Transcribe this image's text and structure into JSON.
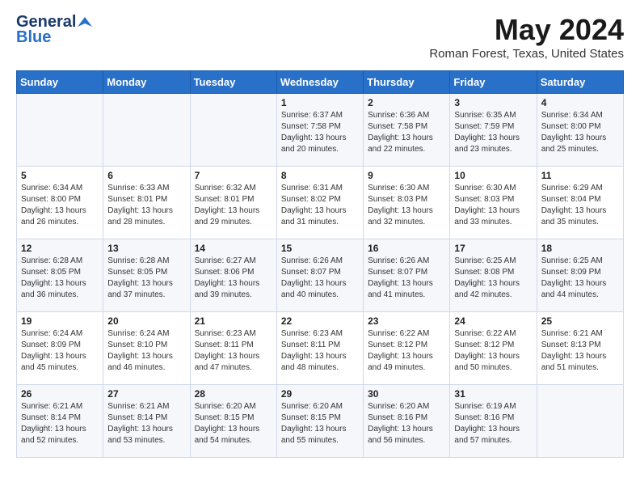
{
  "header": {
    "logo_line1": "General",
    "logo_line2": "Blue",
    "title": "May 2024",
    "subtitle": "Roman Forest, Texas, United States"
  },
  "days_of_week": [
    "Sunday",
    "Monday",
    "Tuesday",
    "Wednesday",
    "Thursday",
    "Friday",
    "Saturday"
  ],
  "weeks": [
    [
      {
        "day": "",
        "info": ""
      },
      {
        "day": "",
        "info": ""
      },
      {
        "day": "",
        "info": ""
      },
      {
        "day": "1",
        "info": "Sunrise: 6:37 AM\nSunset: 7:58 PM\nDaylight: 13 hours\nand 20 minutes."
      },
      {
        "day": "2",
        "info": "Sunrise: 6:36 AM\nSunset: 7:58 PM\nDaylight: 13 hours\nand 22 minutes."
      },
      {
        "day": "3",
        "info": "Sunrise: 6:35 AM\nSunset: 7:59 PM\nDaylight: 13 hours\nand 23 minutes."
      },
      {
        "day": "4",
        "info": "Sunrise: 6:34 AM\nSunset: 8:00 PM\nDaylight: 13 hours\nand 25 minutes."
      }
    ],
    [
      {
        "day": "5",
        "info": "Sunrise: 6:34 AM\nSunset: 8:00 PM\nDaylight: 13 hours\nand 26 minutes."
      },
      {
        "day": "6",
        "info": "Sunrise: 6:33 AM\nSunset: 8:01 PM\nDaylight: 13 hours\nand 28 minutes."
      },
      {
        "day": "7",
        "info": "Sunrise: 6:32 AM\nSunset: 8:01 PM\nDaylight: 13 hours\nand 29 minutes."
      },
      {
        "day": "8",
        "info": "Sunrise: 6:31 AM\nSunset: 8:02 PM\nDaylight: 13 hours\nand 31 minutes."
      },
      {
        "day": "9",
        "info": "Sunrise: 6:30 AM\nSunset: 8:03 PM\nDaylight: 13 hours\nand 32 minutes."
      },
      {
        "day": "10",
        "info": "Sunrise: 6:30 AM\nSunset: 8:03 PM\nDaylight: 13 hours\nand 33 minutes."
      },
      {
        "day": "11",
        "info": "Sunrise: 6:29 AM\nSunset: 8:04 PM\nDaylight: 13 hours\nand 35 minutes."
      }
    ],
    [
      {
        "day": "12",
        "info": "Sunrise: 6:28 AM\nSunset: 8:05 PM\nDaylight: 13 hours\nand 36 minutes."
      },
      {
        "day": "13",
        "info": "Sunrise: 6:28 AM\nSunset: 8:05 PM\nDaylight: 13 hours\nand 37 minutes."
      },
      {
        "day": "14",
        "info": "Sunrise: 6:27 AM\nSunset: 8:06 PM\nDaylight: 13 hours\nand 39 minutes."
      },
      {
        "day": "15",
        "info": "Sunrise: 6:26 AM\nSunset: 8:07 PM\nDaylight: 13 hours\nand 40 minutes."
      },
      {
        "day": "16",
        "info": "Sunrise: 6:26 AM\nSunset: 8:07 PM\nDaylight: 13 hours\nand 41 minutes."
      },
      {
        "day": "17",
        "info": "Sunrise: 6:25 AM\nSunset: 8:08 PM\nDaylight: 13 hours\nand 42 minutes."
      },
      {
        "day": "18",
        "info": "Sunrise: 6:25 AM\nSunset: 8:09 PM\nDaylight: 13 hours\nand 44 minutes."
      }
    ],
    [
      {
        "day": "19",
        "info": "Sunrise: 6:24 AM\nSunset: 8:09 PM\nDaylight: 13 hours\nand 45 minutes."
      },
      {
        "day": "20",
        "info": "Sunrise: 6:24 AM\nSunset: 8:10 PM\nDaylight: 13 hours\nand 46 minutes."
      },
      {
        "day": "21",
        "info": "Sunrise: 6:23 AM\nSunset: 8:11 PM\nDaylight: 13 hours\nand 47 minutes."
      },
      {
        "day": "22",
        "info": "Sunrise: 6:23 AM\nSunset: 8:11 PM\nDaylight: 13 hours\nand 48 minutes."
      },
      {
        "day": "23",
        "info": "Sunrise: 6:22 AM\nSunset: 8:12 PM\nDaylight: 13 hours\nand 49 minutes."
      },
      {
        "day": "24",
        "info": "Sunrise: 6:22 AM\nSunset: 8:12 PM\nDaylight: 13 hours\nand 50 minutes."
      },
      {
        "day": "25",
        "info": "Sunrise: 6:21 AM\nSunset: 8:13 PM\nDaylight: 13 hours\nand 51 minutes."
      }
    ],
    [
      {
        "day": "26",
        "info": "Sunrise: 6:21 AM\nSunset: 8:14 PM\nDaylight: 13 hours\nand 52 minutes."
      },
      {
        "day": "27",
        "info": "Sunrise: 6:21 AM\nSunset: 8:14 PM\nDaylight: 13 hours\nand 53 minutes."
      },
      {
        "day": "28",
        "info": "Sunrise: 6:20 AM\nSunset: 8:15 PM\nDaylight: 13 hours\nand 54 minutes."
      },
      {
        "day": "29",
        "info": "Sunrise: 6:20 AM\nSunset: 8:15 PM\nDaylight: 13 hours\nand 55 minutes."
      },
      {
        "day": "30",
        "info": "Sunrise: 6:20 AM\nSunset: 8:16 PM\nDaylight: 13 hours\nand 56 minutes."
      },
      {
        "day": "31",
        "info": "Sunrise: 6:19 AM\nSunset: 8:16 PM\nDaylight: 13 hours\nand 57 minutes."
      },
      {
        "day": "",
        "info": ""
      }
    ]
  ]
}
